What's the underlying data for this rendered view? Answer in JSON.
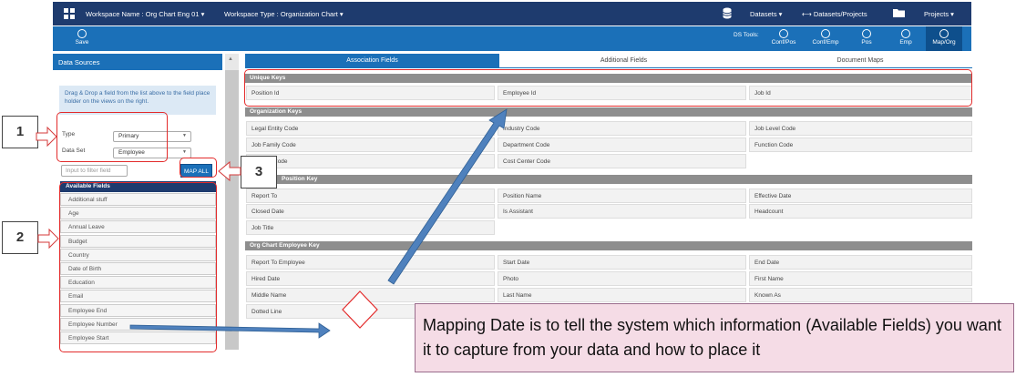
{
  "topbar": {
    "workspace_name": "Workspace Name : Org Chart Eng 01 ▾",
    "workspace_type": "Workspace Type : Organization Chart ▾",
    "datasets": "Datasets ▾",
    "datasets_projects": "Datasets/Projects",
    "projects": "Projects ▾"
  },
  "toolbar": {
    "save": "Save",
    "ds_tools_label": "DS Tools:",
    "tools": [
      "Conf/Pos",
      "Conf/Emp",
      "Pos",
      "Emp",
      "Map/Org"
    ]
  },
  "left_panel": {
    "header": "Data Sources",
    "hint": "Drag & Drop a field from the list above to the field place holder on the views on the right.",
    "type_label": "Type",
    "type_value": "Primary",
    "dataset_label": "Data Set",
    "dataset_value": "Employee",
    "filter_placeholder": "Input to filter field",
    "map_all": "MAP ALL",
    "available_fields_header": "Available Fields",
    "available_fields": [
      "Additional stuff",
      "Age",
      "Annual Leave",
      "Budget",
      "Country",
      "Date of Birth",
      "Education",
      "Email",
      "Employee End",
      "Employee Number",
      "Employee Start"
    ]
  },
  "main": {
    "tabs": [
      "Association Fields",
      "Additional Fields",
      "Document Maps"
    ],
    "sections": [
      {
        "title": "Unique Keys",
        "rows": [
          [
            "Position Id",
            "Employee Id",
            "Job Id"
          ]
        ]
      },
      {
        "title": "Organization Keys",
        "rows": [
          [
            "Legal Entity Code",
            "Industry Code",
            "Job Level Code"
          ],
          [
            "Job Family Code",
            "Department Code",
            "Function Code"
          ],
          [
            "Code",
            "Cost Center Code",
            ""
          ]
        ]
      },
      {
        "title": "Position Key",
        "rows": [
          [
            "Report To",
            "Position Name",
            "Effective Date"
          ],
          [
            "Closed Date",
            "Is Assistant",
            "Headcount"
          ],
          [
            "Job Title",
            "",
            ""
          ]
        ]
      },
      {
        "title": "Org Chart Employee Key",
        "rows": [
          [
            "Report To Employee",
            "Start Date",
            "End Date"
          ],
          [
            "Hired Date",
            "Photo",
            "First Name"
          ],
          [
            "Middle Name",
            "Last Name",
            "Known As"
          ],
          [
            "Dotted Line",
            "",
            ""
          ]
        ]
      }
    ]
  },
  "annotations": {
    "labels": [
      "1",
      "2",
      "3"
    ],
    "callout": "Mapping Date is to tell the system which information (Available Fields) you want it to capture from your data and how to place it"
  },
  "colors": {
    "nav": "#1e3b6e",
    "toolbar": "#1b70b8",
    "section_header": "#8e8e8e",
    "annotation_red": "#e32b2b",
    "callout_bg": "#f5dce6",
    "arrow_blue": "#4f81bd"
  }
}
